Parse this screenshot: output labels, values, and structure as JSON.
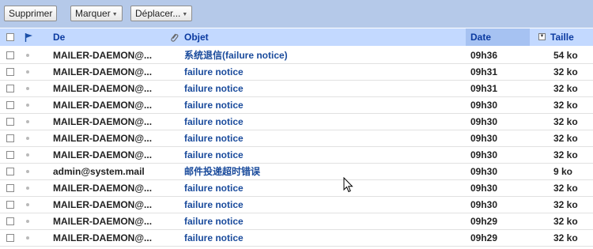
{
  "toolbar": {
    "delete_label": "Supprimer",
    "mark_label": "Marquer",
    "move_label": "Déplacer..."
  },
  "columns": {
    "from": "De",
    "subject": "Objet",
    "date": "Date",
    "size": "Taille"
  },
  "colors": {
    "toolbar_bg": "#b5c9e9",
    "header_bg": "#c3d9ff",
    "header_text": "#0b3aa0",
    "subject_text": "#1a4b9c"
  },
  "messages": [
    {
      "from": "MAILER-DAEMON@...",
      "subject": "系统退信(failure notice)",
      "date": "09h36",
      "size": "54 ko"
    },
    {
      "from": "MAILER-DAEMON@...",
      "subject": "failure notice",
      "date": "09h31",
      "size": "32 ko"
    },
    {
      "from": "MAILER-DAEMON@...",
      "subject": "failure notice",
      "date": "09h31",
      "size": "32 ko"
    },
    {
      "from": "MAILER-DAEMON@...",
      "subject": "failure notice",
      "date": "09h30",
      "size": "32 ko"
    },
    {
      "from": "MAILER-DAEMON@...",
      "subject": "failure notice",
      "date": "09h30",
      "size": "32 ko"
    },
    {
      "from": "MAILER-DAEMON@...",
      "subject": "failure notice",
      "date": "09h30",
      "size": "32 ko"
    },
    {
      "from": "MAILER-DAEMON@...",
      "subject": "failure notice",
      "date": "09h30",
      "size": "32 ko"
    },
    {
      "from": "admin@system.mail",
      "subject": "邮件投递超时错误",
      "date": "09h30",
      "size": "9 ko"
    },
    {
      "from": "MAILER-DAEMON@...",
      "subject": "failure notice",
      "date": "09h30",
      "size": "32 ko"
    },
    {
      "from": "MAILER-DAEMON@...",
      "subject": "failure notice",
      "date": "09h30",
      "size": "32 ko"
    },
    {
      "from": "MAILER-DAEMON@...",
      "subject": "failure notice",
      "date": "09h29",
      "size": "32 ko"
    },
    {
      "from": "MAILER-DAEMON@...",
      "subject": "failure notice",
      "date": "09h29",
      "size": "32 ko"
    }
  ]
}
